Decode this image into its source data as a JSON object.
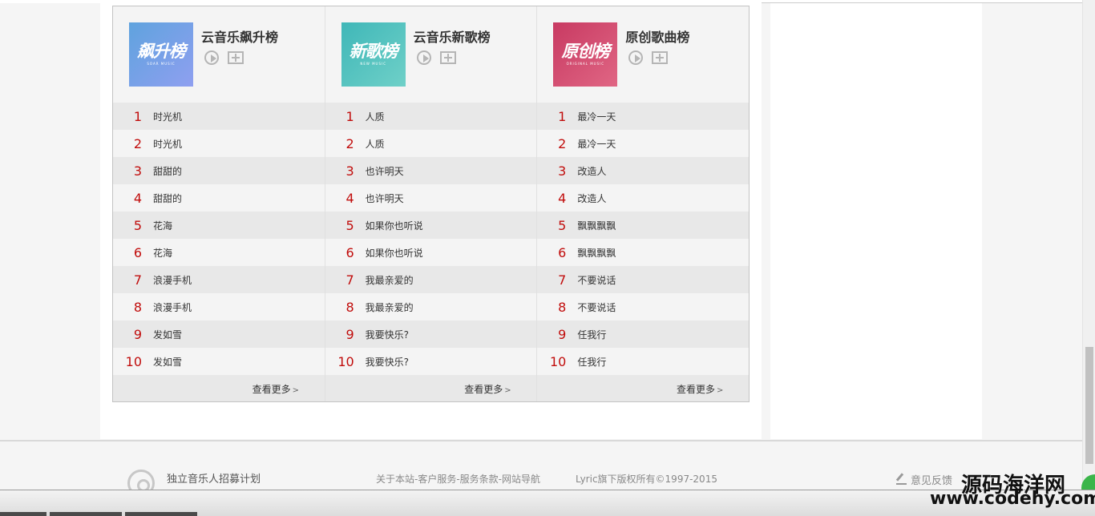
{
  "charts": [
    {
      "name": "云音乐飙升榜",
      "cover_text": "飙升榜",
      "cover_sub": "SOAR MUSIC",
      "cover_color": "#6d9ee8",
      "songs": [
        {
          "rank": "1",
          "title": "时光机"
        },
        {
          "rank": "2",
          "title": "时光机"
        },
        {
          "rank": "3",
          "title": "甜甜的"
        },
        {
          "rank": "4",
          "title": "甜甜的"
        },
        {
          "rank": "5",
          "title": "花海"
        },
        {
          "rank": "6",
          "title": "花海"
        },
        {
          "rank": "7",
          "title": "浪漫手机"
        },
        {
          "rank": "8",
          "title": "浪漫手机"
        },
        {
          "rank": "9",
          "title": "发如雪"
        },
        {
          "rank": "10",
          "title": "发如雪"
        }
      ],
      "more": "查看更多",
      "more_arrow": ">"
    },
    {
      "name": "云音乐新歌榜",
      "cover_text": "新歌榜",
      "cover_sub": "NEW MUSIC",
      "cover_color": "#4fc0bd",
      "songs": [
        {
          "rank": "1",
          "title": "人质"
        },
        {
          "rank": "2",
          "title": "人质"
        },
        {
          "rank": "3",
          "title": "也许明天"
        },
        {
          "rank": "4",
          "title": "也许明天"
        },
        {
          "rank": "5",
          "title": "如果你也听说"
        },
        {
          "rank": "6",
          "title": "如果你也听说"
        },
        {
          "rank": "7",
          "title": "我最亲爱的"
        },
        {
          "rank": "8",
          "title": "我最亲爱的"
        },
        {
          "rank": "9",
          "title": "我要快乐?"
        },
        {
          "rank": "10",
          "title": "我要快乐?"
        }
      ],
      "more": "查看更多",
      "more_arrow": ">"
    },
    {
      "name": "原创歌曲榜",
      "cover_text": "原创榜",
      "cover_sub": "ORIGINAL MUSIC",
      "cover_color": "#d0486a",
      "songs": [
        {
          "rank": "1",
          "title": "最冷一天"
        },
        {
          "rank": "2",
          "title": "最冷一天"
        },
        {
          "rank": "3",
          "title": "改造人"
        },
        {
          "rank": "4",
          "title": "改造人"
        },
        {
          "rank": "5",
          "title": "飘飘飘飘"
        },
        {
          "rank": "6",
          "title": "飘飘飘飘"
        },
        {
          "rank": "7",
          "title": "不要说话"
        },
        {
          "rank": "8",
          "title": "不要说话"
        },
        {
          "rank": "9",
          "title": "任我行"
        },
        {
          "rank": "10",
          "title": "任我行"
        }
      ],
      "more": "查看更多",
      "more_arrow": ">"
    }
  ],
  "footer": {
    "musician_label": "独立音乐人招募计划",
    "links": "关于本站-客户服务-服务条款-网站导航",
    "copyright": "Lyric旗下版权所有©1997-2015",
    "feedback": "意见反馈"
  },
  "watermark": {
    "line1": "源码海洋网",
    "line2": "www.codehy.com"
  },
  "colors": {
    "rank": "#c10d0c",
    "row_odd": "#e8e8e8",
    "row_even": "#f4f4f4"
  }
}
